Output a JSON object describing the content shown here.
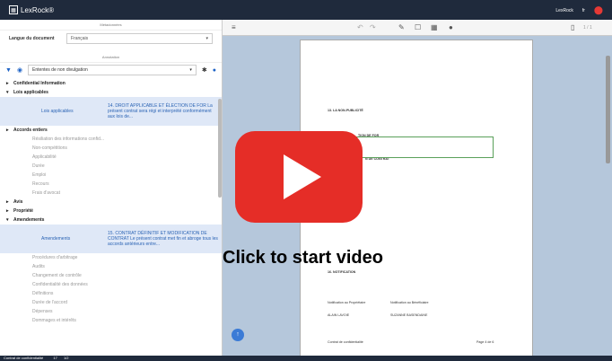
{
  "app": {
    "name": "LexRock®",
    "user": "LexRock",
    "lang": "fr"
  },
  "left_panel": {
    "metadata_header": "Métadonnées",
    "annotation_header": "Annotation",
    "language_label": "Langue du document",
    "language_value": "Français",
    "filter_value": "Ententes de non divulgation",
    "tree": {
      "cat1": "Confidential Information",
      "cat2": "Lois applicables",
      "sel1_label": "Lois applicables",
      "sel1_text": "14. DROIT APPLICABLE ET ÉLECTION DE FOR La présent contrat sera régi et interprété conformément aux lois de...",
      "cat3": "Accords entiers",
      "items1": [
        "Résiliation des informations confid...",
        "Non-compétitions",
        "Applicabilité",
        "Durée",
        "Emploi",
        "Recours",
        "Frais d'avocat"
      ],
      "cat4": "Avis",
      "cat5": "Propriété",
      "cat6": "Amendements",
      "sel2_label": "Amendements",
      "sel2_text": "15. CONTRAT DÉFINITIF ET MODIFICATION DE CONTRAT Le présent contrat met fin et abroge tous les accords antérieurs entre...",
      "items2": [
        "Procédures d'arbitrage",
        "Audits",
        "Changement de contrôle",
        "Confidentialité des données",
        "Définitions",
        "Durée de l'accord",
        "Dépenses",
        "Dommages et intérêts"
      ]
    }
  },
  "viewer": {
    "page_indicator": "1 / 1",
    "doc_headings": [
      "13. LA NON-PUBLICITÉ",
      "TION DE FOR",
      "N DE CONTRAT",
      "16. NOTIFICATION"
    ],
    "footer_left": "Contrat de confidentialité",
    "footer_right": "Page 4 de 6",
    "sig_left": "Notification au Propriétaire",
    "sig_right": "Notification au Bénéficiaire",
    "name_left": "ALAIN LAVOIE",
    "name_right": "SUZANNE BASENDAINE"
  },
  "statusbar": {
    "text": "Contrat de confidentialité",
    "count": "17",
    "pages": "1/2"
  },
  "video_overlay": {
    "cta": "Click to start video"
  }
}
